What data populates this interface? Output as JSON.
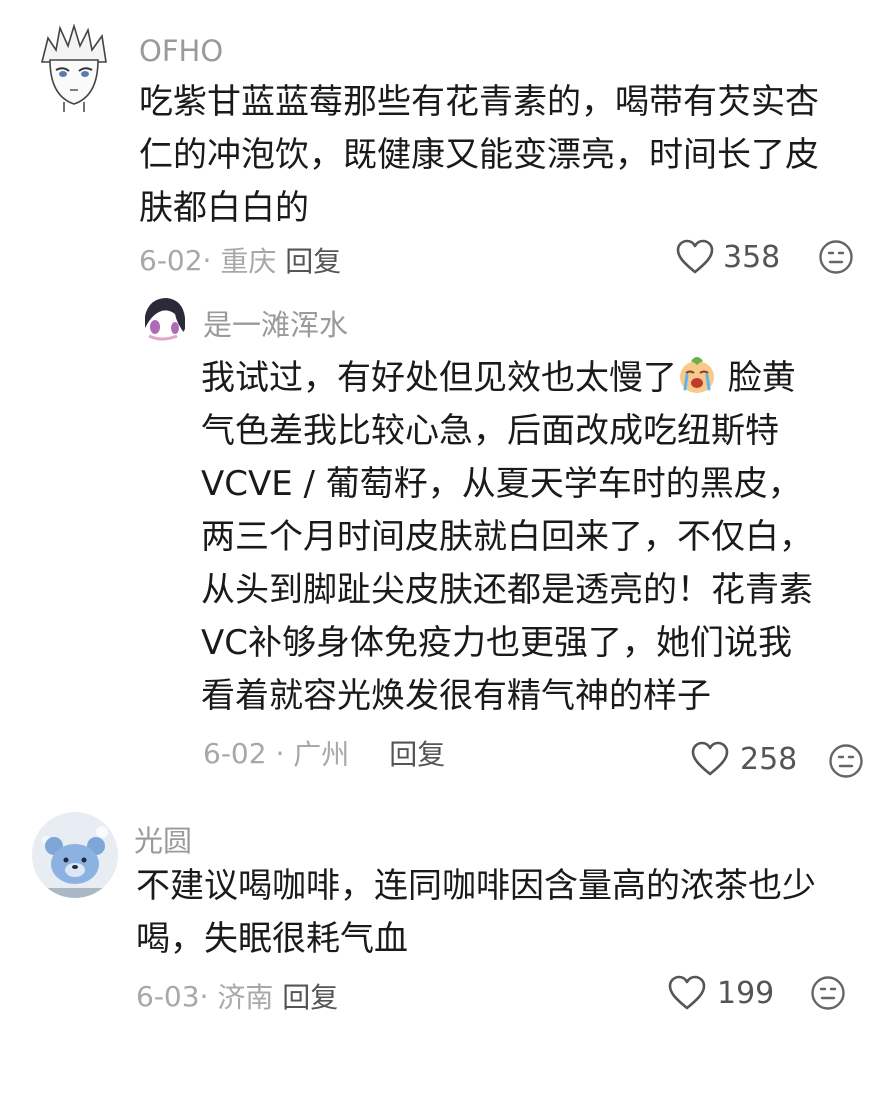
{
  "comments": [
    {
      "username": "OFHO",
      "lines": [
        "吃紫甘蓝蓝莓那些有花青素的，喝带有芡实杏",
        "仁的冲泡饮，既健康又能变漂亮，时间长了皮",
        "肤都白白的"
      ],
      "date": "6-02",
      "location": "重庆",
      "reply_label": "回复",
      "likes": "358",
      "avatar_icon": "anime-boy-avatar"
    },
    {
      "username": "是一滩浑水",
      "lines_before_emoji": "我试过，有好处但见效也太慢了",
      "emoji": "crying-face-emoji",
      "lines_after_emoji": " 脸黄",
      "lines": [
        "气色差我比较心急，后面改成吃纽斯特",
        "VCVE / 葡萄籽，从夏天学车时的黑皮，",
        "两三个月时间皮肤就白回来了，不仅白，",
        "从头到脚趾尖皮肤还都是透亮的！花青素",
        "VC补够身体免疫力也更强了，她们说我",
        "看着就容光焕发很有精气神的样子"
      ],
      "date": "6-02",
      "location": "广州",
      "reply_label": "回复",
      "likes": "258",
      "avatar_icon": "anime-girl-avatar"
    },
    {
      "username": "光圆",
      "lines": [
        "不建议喝咖啡，连同咖啡因含量高的浓茶也少",
        "喝，失眠很耗气血"
      ],
      "date": "6-03",
      "location": "济南",
      "reply_label": "回复",
      "likes": "199",
      "avatar_icon": "blue-bear-avatar"
    }
  ],
  "colors": {
    "muted_text": "#9a9a9a",
    "body_text": "#1a1a1a",
    "icon_stroke": "#555555"
  }
}
